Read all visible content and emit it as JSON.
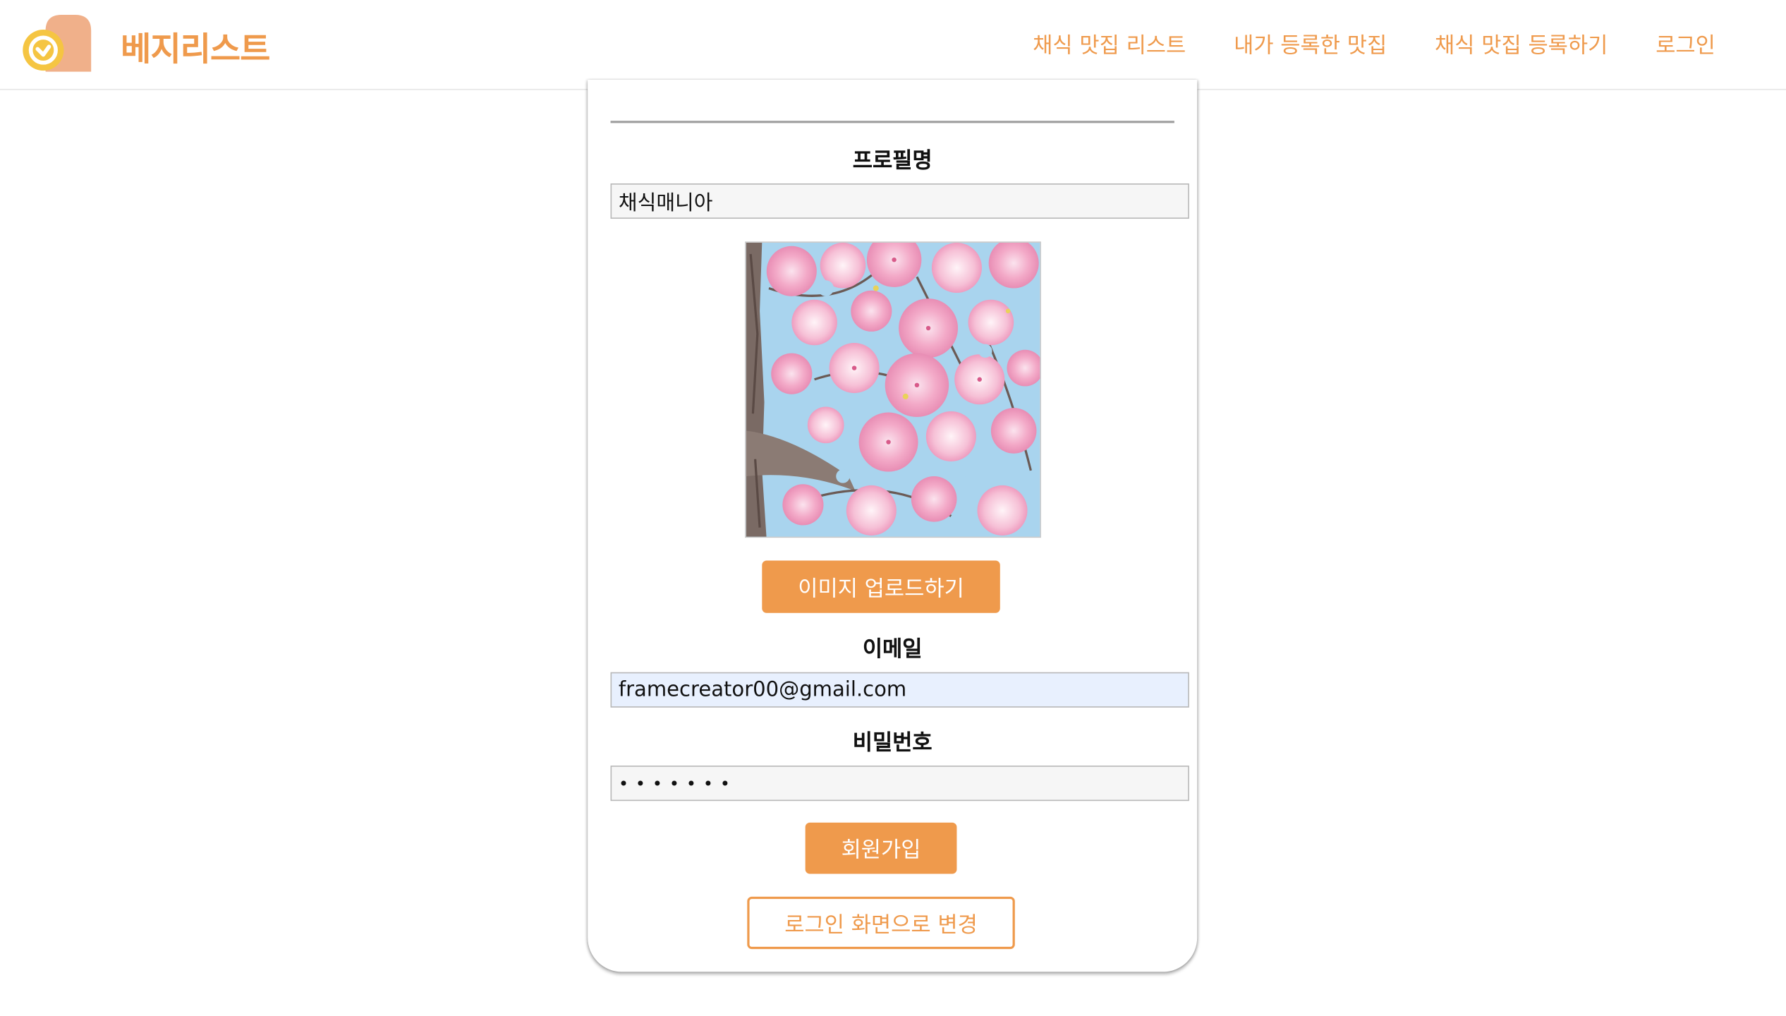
{
  "header": {
    "brand": "베지리스트",
    "logo_icon": "check-badge-icon",
    "nav": [
      {
        "label": "채식 맛집 리스트"
      },
      {
        "label": "내가 등록한 맛집"
      },
      {
        "label": "채식 맛집 등록하기"
      },
      {
        "label": "로그인"
      }
    ]
  },
  "form": {
    "profile_label": "프로필명",
    "profile_value": "채식매니아",
    "photo_subject": "cherry-blossom-photo",
    "upload_label": "이미지 업로드하기",
    "email_label": "이메일",
    "email_value": "framecreator00@gmail.com",
    "password_label": "비밀번호",
    "password_value": "•••••••",
    "signup_label": "회원가입",
    "switch_label": "로그인 화면으로 변경"
  },
  "colors": {
    "accent": "#ef9a4c",
    "logo_yellow": "#f5c542",
    "logo_peach": "#f0b08a",
    "email_autofill": "#e8f0fe"
  }
}
